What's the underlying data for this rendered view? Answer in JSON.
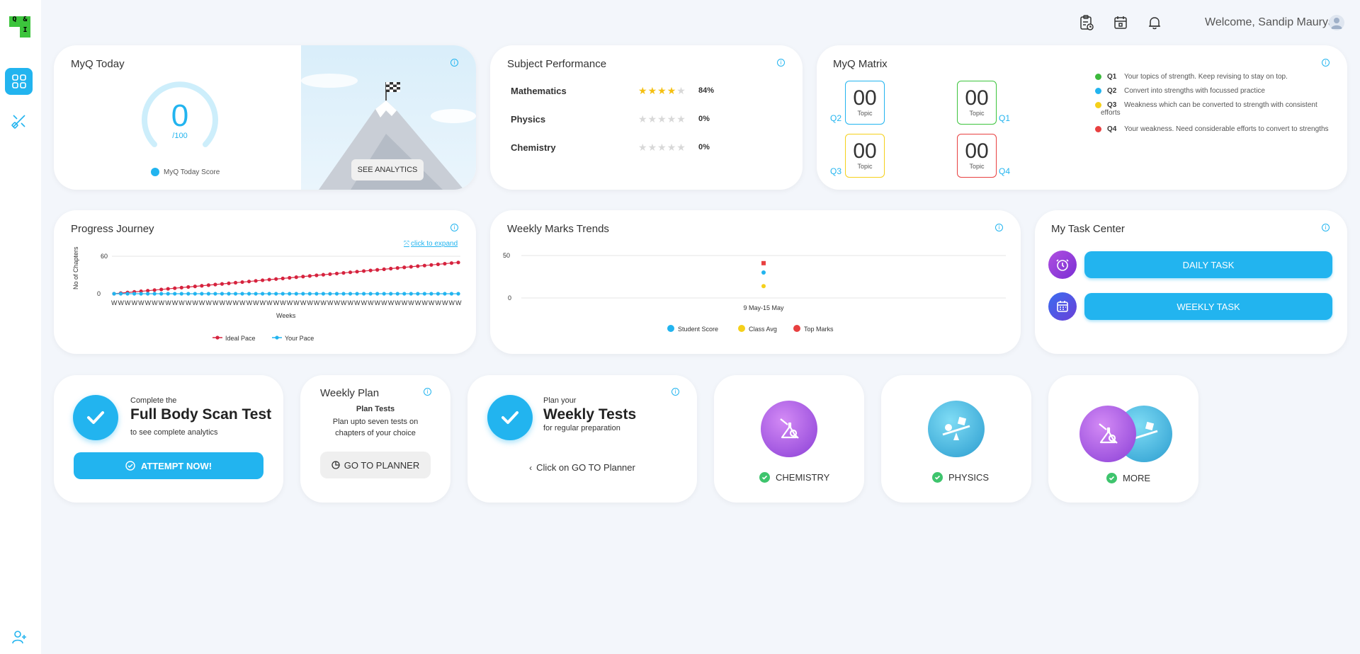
{
  "app": {
    "logo_text": [
      "Q",
      "&",
      "",
      "I"
    ]
  },
  "header": {
    "welcome": "Welcome, Sandip Maurya"
  },
  "myq_today": {
    "title": "MyQ Today",
    "score": "0",
    "out_of": "/100",
    "legend": "MyQ Today Score",
    "analytics_btn": "SEE ANALYTICS"
  },
  "subject_performance": {
    "title": "Subject Performance",
    "rows": [
      {
        "subject": "Mathematics",
        "stars": 4,
        "percent": "84%"
      },
      {
        "subject": "Physics",
        "stars": 0,
        "percent": "0%"
      },
      {
        "subject": "Chemistry",
        "stars": 0,
        "percent": "0%"
      }
    ]
  },
  "myq_matrix": {
    "title": "MyQ Matrix",
    "boxes": [
      {
        "quadrant": "Q2",
        "value": "00",
        "label": "Topic",
        "color": "#22b4ef"
      },
      {
        "quadrant": "Q1",
        "value": "00",
        "label": "Topic",
        "color": "#3cc43c"
      },
      {
        "quadrant": "Q3",
        "value": "00",
        "label": "Topic",
        "color": "#f5d01a"
      },
      {
        "quadrant": "Q4",
        "value": "00",
        "label": "Topic",
        "color": "#e84040"
      }
    ],
    "legend": [
      {
        "q": "Q1",
        "text": "Your topics of strength. Keep revising to stay on top.",
        "color": "#3cb93c"
      },
      {
        "q": "Q2",
        "text": "Convert into strengths with focussed practice",
        "color": "#22b4ef"
      },
      {
        "q": "Q3",
        "text": "Weakness which can be converted to strength with consistent efforts",
        "color": "#f5d01a"
      },
      {
        "q": "Q4",
        "text": "Your weakness. Need considerable efforts to convert to strengths",
        "color": "#e84040"
      }
    ]
  },
  "progress_journey": {
    "title": "Progress Journey",
    "expand_link": "click to expand",
    "chart_data": {
      "type": "line",
      "ylabel": "No of Chapters",
      "xlabel": "Weeks",
      "ylim": [
        0,
        60
      ],
      "yticks": [
        "60",
        "0"
      ],
      "x_tick_label": "W",
      "points_count": 52,
      "series": [
        {
          "name": "Ideal Pace",
          "color": "#d6233e",
          "start": 0,
          "end": 50
        },
        {
          "name": "Your Pace",
          "color": "#22b4ef",
          "start": 0,
          "end": 0
        }
      ]
    }
  },
  "weekly_marks": {
    "title": "Weekly Marks Trends",
    "chart_data": {
      "type": "scatter",
      "categories": [
        "9 May-15 May"
      ],
      "ylim": [
        0,
        50
      ],
      "yticks": [
        "50",
        "0"
      ],
      "series": [
        {
          "name": "Student Score",
          "color": "#22b4ef",
          "values": [
            30
          ]
        },
        {
          "name": "Class Avg",
          "color": "#f5d01a",
          "values": [
            14
          ]
        },
        {
          "name": "Top Marks",
          "color": "#e84040",
          "values": [
            41
          ]
        }
      ]
    }
  },
  "task_center": {
    "title": "My Task Center",
    "daily": "DAILY TASK",
    "weekly": "WEEKLY TASK"
  },
  "full_body": {
    "line1": "Complete the",
    "title": "Full Body Scan Test",
    "line3": "to see complete analytics",
    "btn": "ATTEMPT NOW!"
  },
  "weekly_plan": {
    "title": "Weekly Plan",
    "subtitle": "Plan Tests",
    "desc": "Plan upto seven tests on chapters of your choice",
    "btn": "GO TO PLANNER"
  },
  "weekly_tests": {
    "line1": "Plan your",
    "title": "Weekly Tests",
    "line3": "for regular preparation",
    "hint": "Click on GO TO Planner"
  },
  "subjects": [
    {
      "label": "CHEMISTRY"
    },
    {
      "label": "PHYSICS"
    },
    {
      "label": "MORE"
    }
  ]
}
